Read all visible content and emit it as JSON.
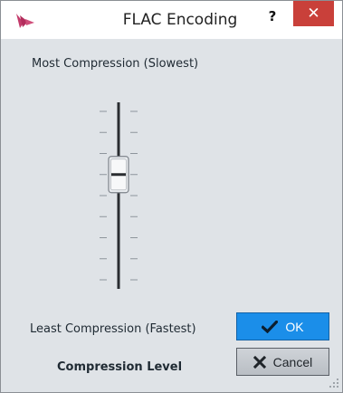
{
  "window": {
    "title": "FLAC Encoding",
    "help_label": "?",
    "close_label": "✕"
  },
  "labels": {
    "top": "Most Compression (Slowest)",
    "bottom": "Least Compression (Fastest)",
    "compression_level": "Compression Level"
  },
  "slider": {
    "levels": 9,
    "selected_index": 3
  },
  "buttons": {
    "ok_label": "OK",
    "ok_icon": "check-icon",
    "cancel_label": "Cancel",
    "cancel_icon": "x-icon"
  },
  "colors": {
    "accent": "#1b8ee9",
    "close": "#c9403a",
    "background": "#dfe3e7"
  }
}
